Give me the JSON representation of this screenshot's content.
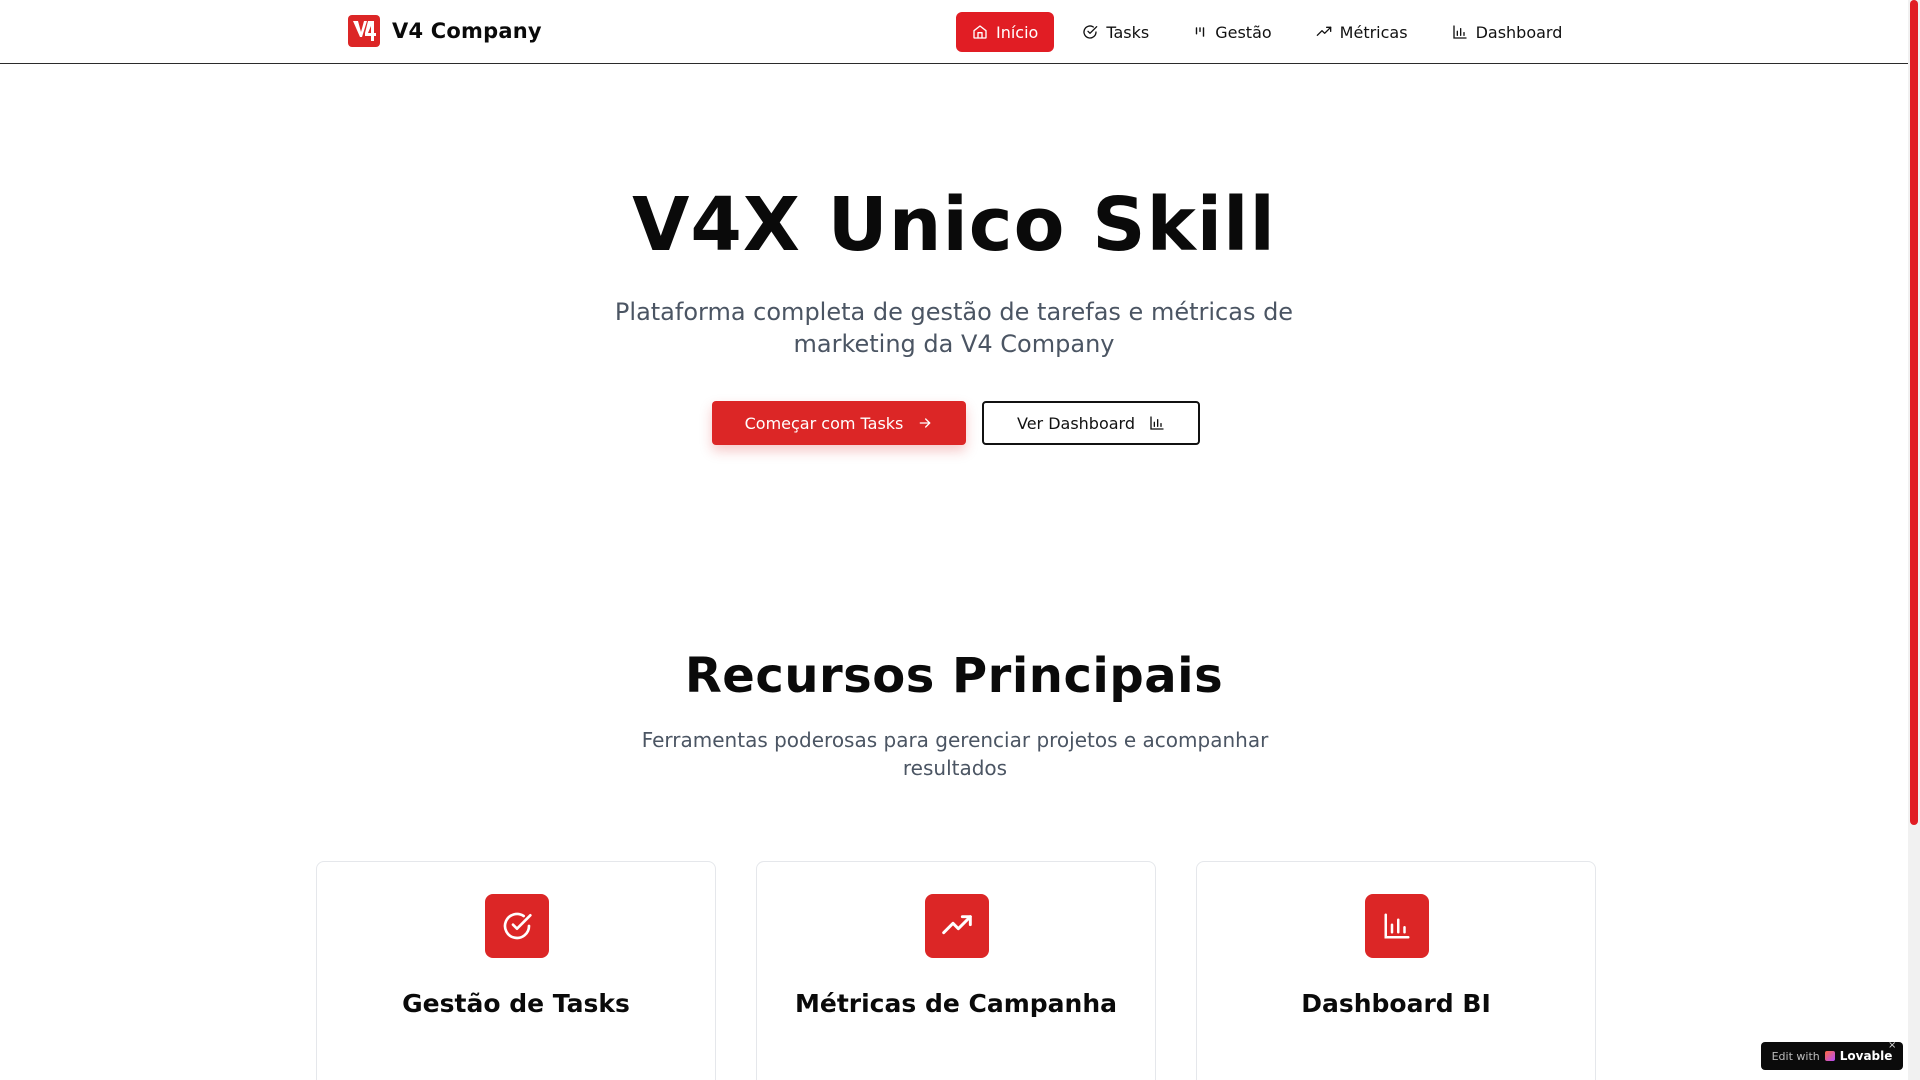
{
  "brand": {
    "name": "V4 Company",
    "logo_icon": "v4-logo-icon"
  },
  "nav": {
    "items": [
      {
        "label": "Início",
        "icon": "home-icon",
        "active": true
      },
      {
        "label": "Tasks",
        "icon": "check-circle-icon",
        "active": false
      },
      {
        "label": "Gestão",
        "icon": "kanban-icon",
        "active": false
      },
      {
        "label": "Métricas",
        "icon": "trending-up-icon",
        "active": false
      },
      {
        "label": "Dashboard",
        "icon": "bar-chart-icon",
        "active": false
      }
    ]
  },
  "hero": {
    "title": "V4X Unico Skill",
    "subtitle": "Plataforma completa de gestão de tarefas e métricas de marketing da V4 Company",
    "primary_button": "Começar com Tasks",
    "secondary_button": "Ver Dashboard"
  },
  "features": {
    "title": "Recursos Principais",
    "subtitle": "Ferramentas poderosas para gerenciar projetos e acompanhar resultados",
    "cards": [
      {
        "title": "Gestão de Tasks",
        "icon": "check-circle-icon"
      },
      {
        "title": "Métricas de Campanha",
        "icon": "trending-up-icon"
      },
      {
        "title": "Dashboard BI",
        "icon": "bar-chart-icon"
      }
    ]
  },
  "badge": {
    "prefix": "Edit with",
    "brand": "Lovable",
    "close": "×"
  },
  "colors": {
    "accent": "#dc2626",
    "text": "#0a0a0a",
    "muted": "#4b5563",
    "border": "#e5e7eb"
  }
}
